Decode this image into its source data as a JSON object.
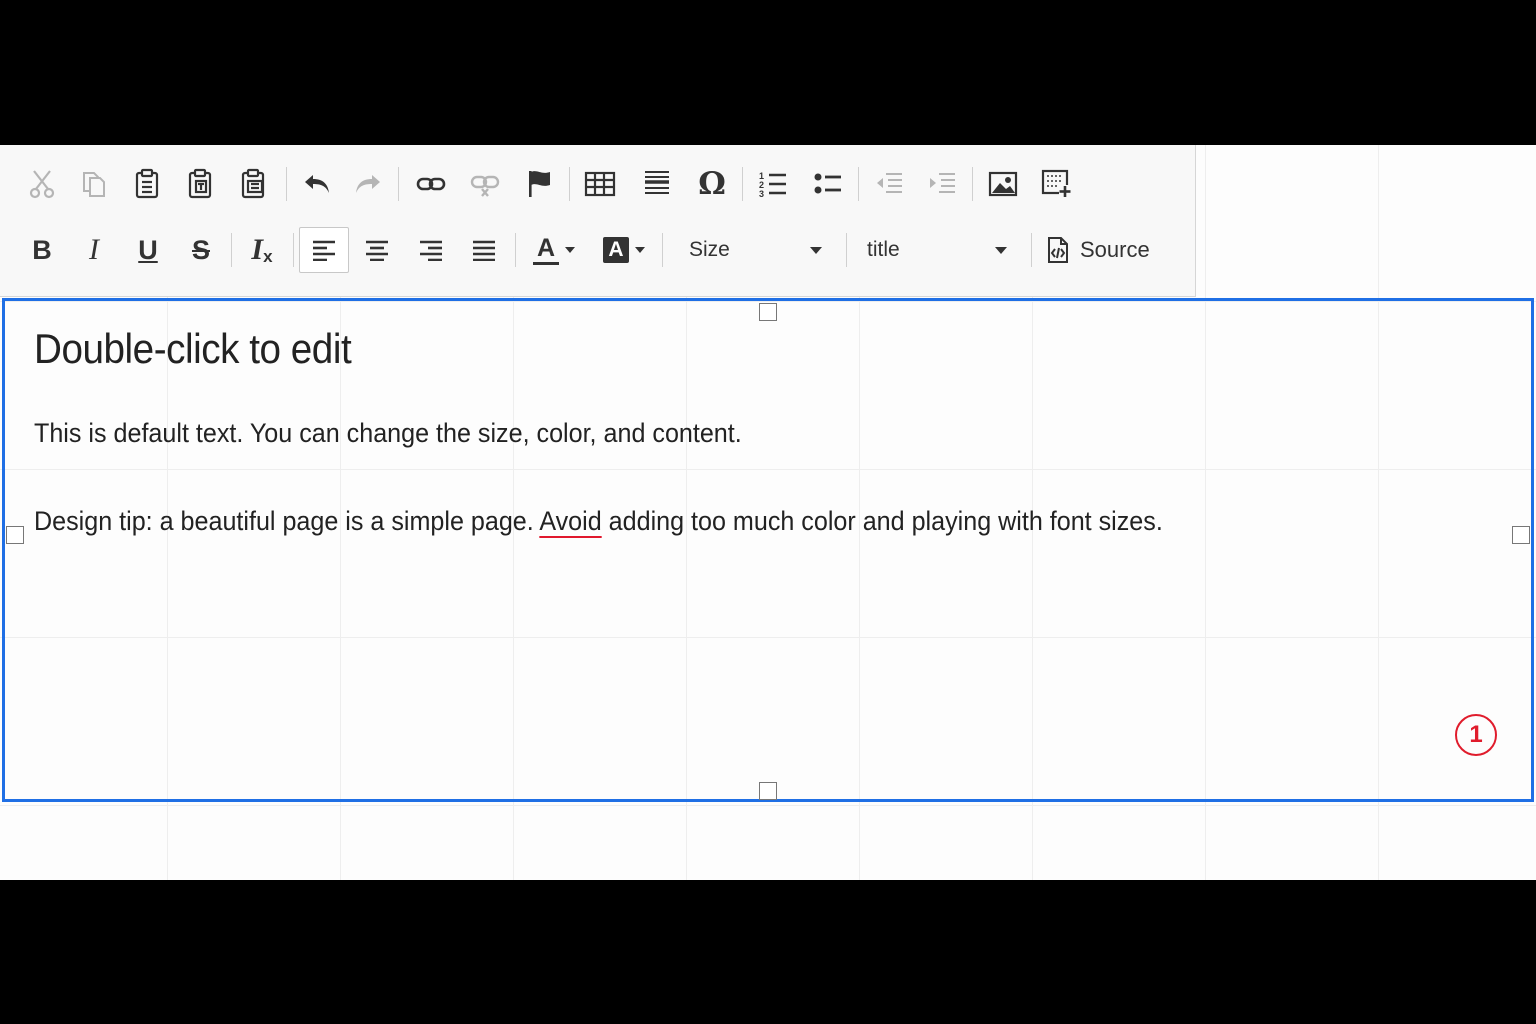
{
  "toolbar": {
    "row1": [
      {
        "name": "cut-icon",
        "enabled": false
      },
      {
        "name": "copy-icon",
        "enabled": false
      },
      {
        "name": "paste-icon",
        "enabled": true
      },
      {
        "name": "paste-text-icon",
        "enabled": true
      },
      {
        "name": "paste-from-word-icon",
        "enabled": true
      },
      {
        "name": "undo-icon",
        "enabled": true
      },
      {
        "name": "redo-icon",
        "enabled": false
      },
      {
        "name": "link-icon",
        "enabled": true
      },
      {
        "name": "unlink-icon",
        "enabled": false
      },
      {
        "name": "anchor-flag-icon",
        "enabled": true
      },
      {
        "name": "table-icon",
        "enabled": true
      },
      {
        "name": "horizontal-line-icon",
        "enabled": true
      },
      {
        "name": "special-character-icon",
        "enabled": true,
        "glyph": "Ω"
      },
      {
        "name": "numbered-list-icon",
        "enabled": true
      },
      {
        "name": "bulleted-list-icon",
        "enabled": true
      },
      {
        "name": "decrease-indent-icon",
        "enabled": false
      },
      {
        "name": "increase-indent-icon",
        "enabled": false
      },
      {
        "name": "image-icon",
        "enabled": true
      },
      {
        "name": "insert-widget-icon",
        "enabled": true
      }
    ],
    "row2": {
      "bold": "B",
      "italic": "I",
      "underline": "U",
      "strike": "S",
      "remove_format": "I",
      "remove_format_sub": "x",
      "align_left_active": true,
      "text_color_glyph": "A",
      "bg_color_glyph": "A",
      "size_label": "Size",
      "format_label": "title",
      "source_label": "Source"
    },
    "icon_color": "#333333",
    "disabled_color": "#b5b5b5"
  },
  "editor": {
    "heading": "Double-click to edit",
    "paragraph1": "This is default text. You can change the size, color, and content.",
    "paragraph2_before": "Design tip: a beautiful page is a simple page. ",
    "paragraph2_misspelled": "Avoid",
    "paragraph2_after": " adding too much color and playing with font sizes.",
    "selection_color": "#1f6fe5",
    "spellcheck_color": "#e0182d"
  },
  "badge": {
    "number": "1",
    "color": "#e01c2c"
  }
}
